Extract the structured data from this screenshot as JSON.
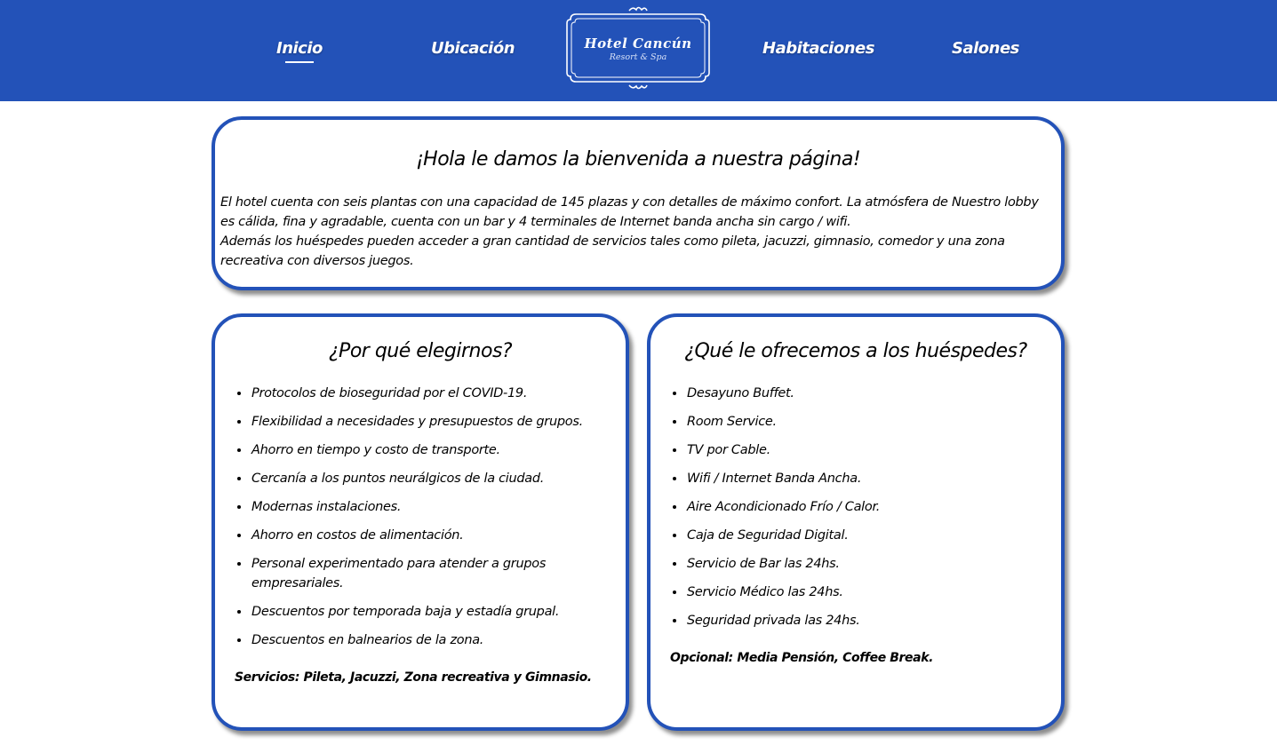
{
  "nav": {
    "links": [
      "Inicio",
      "Ubicación",
      "Habitaciones",
      "Salones"
    ],
    "active": "Inicio",
    "logo": {
      "title": "Hotel Cancún",
      "subtitle": "Resort & Spa"
    }
  },
  "colors": {
    "brand": "#2352b8",
    "background": "#ffffff"
  },
  "welcome": {
    "title": "¡Hola le damos la bienvenida a nuestra página!",
    "paragraph1": "El hotel cuenta con seis plantas con una capacidad de 145 plazas y con detalles de máximo confort. La atmósfera de Nuestro lobby es cálida, fina y agradable, cuenta con un bar y 4 terminales de Internet banda ancha sin cargo / wifi.",
    "paragraph2": "Además los huéspedes pueden acceder a gran cantidad de servicios tales como pileta, jacuzzi, gimnasio, comedor y una zona recreativa con diversos juegos."
  },
  "why": {
    "title": "¿Por qué elegirnos?",
    "items": [
      "Protocolos de bioseguridad por el COVID-19.",
      "Flexibilidad a necesidades y presupuestos de grupos.",
      "Ahorro en tiempo y costo de transporte.",
      "Cercanía a los puntos neurálgicos de la ciudad.",
      "Modernas instalaciones.",
      "Ahorro en costos de alimentación.",
      "Personal experimentado para atender a grupos empresariales.",
      "Descuentos por temporada baja y estadía grupal.",
      "Descuentos en balnearios de la zona."
    ],
    "note": "Servicios: Pileta, Jacuzzi, Zona recreativa y Gimnasio."
  },
  "offer": {
    "title": "¿Qué le ofrecemos a los huéspedes?",
    "items": [
      "Desayuno Buffet.",
      "Room Service.",
      "TV por Cable.",
      "Wifi / Internet Banda Ancha.",
      "Aire Acondicionado Frío / Calor.",
      "Caja de Seguridad Digital.",
      "Servicio de Bar las 24hs.",
      "Servicio Médico las 24hs.",
      "Seguridad privada las 24hs."
    ],
    "note": "Opcional: Media Pensión, Coffee Break."
  }
}
